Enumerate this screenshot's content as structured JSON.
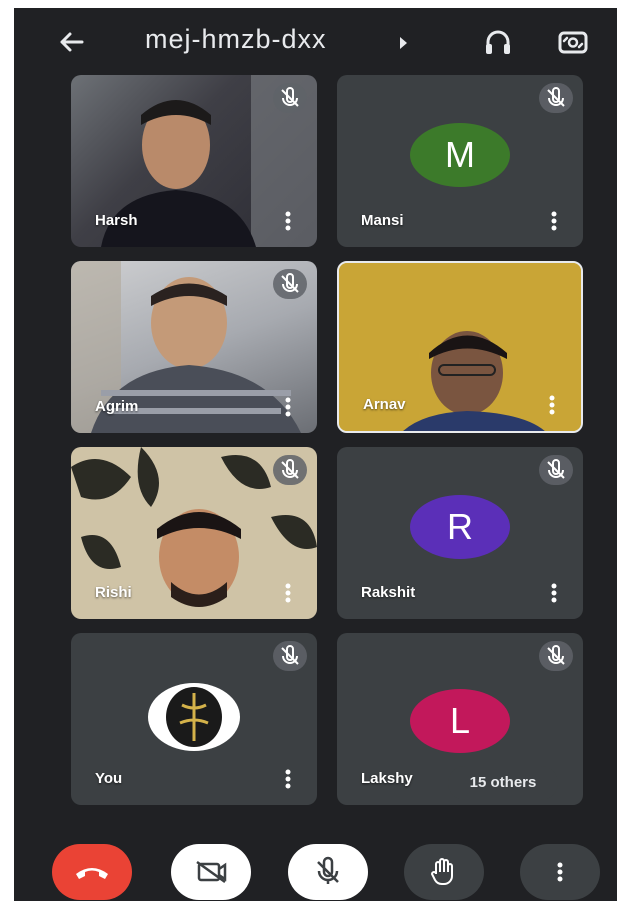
{
  "header": {
    "meeting_code": "mej-hmzb-dxx",
    "icons": [
      "back-arrow-icon",
      "headphones-icon",
      "switch-camera-icon"
    ]
  },
  "participants": [
    {
      "name": "Harsh",
      "type": "video",
      "muted": true
    },
    {
      "name": "Mansi",
      "type": "avatar",
      "initial": "M",
      "color": "#3c7a2a",
      "muted": true
    },
    {
      "name": "Agrim",
      "type": "video",
      "muted": true
    },
    {
      "name": "Arnav",
      "type": "video",
      "muted": false
    },
    {
      "name": "Rishi",
      "type": "video",
      "muted": true
    },
    {
      "name": "Rakshit",
      "type": "avatar",
      "initial": "R",
      "color": "#5b2fb8",
      "muted": true
    },
    {
      "name": "You",
      "type": "logo",
      "muted": true
    },
    {
      "name": "Lakshy",
      "type": "avatar",
      "initial": "L",
      "color": "#c2185b",
      "muted": true
    }
  ],
  "others_chip": "15 others",
  "controls": [
    {
      "name": "end-call",
      "icon": "phone-hangup-icon",
      "color": "#ea4335"
    },
    {
      "name": "camera-off",
      "icon": "camera-off-icon",
      "color": "#ffffff"
    },
    {
      "name": "mic-off",
      "icon": "mic-off-icon",
      "color": "#ffffff"
    },
    {
      "name": "raise-hand",
      "icon": "hand-icon",
      "color": "#3c4043"
    },
    {
      "name": "more-options",
      "icon": "more-vert-icon",
      "color": "#3c4043"
    }
  ],
  "colors": {
    "background": "#202124",
    "tile": "#3c4043",
    "end_call": "#ea4335"
  }
}
